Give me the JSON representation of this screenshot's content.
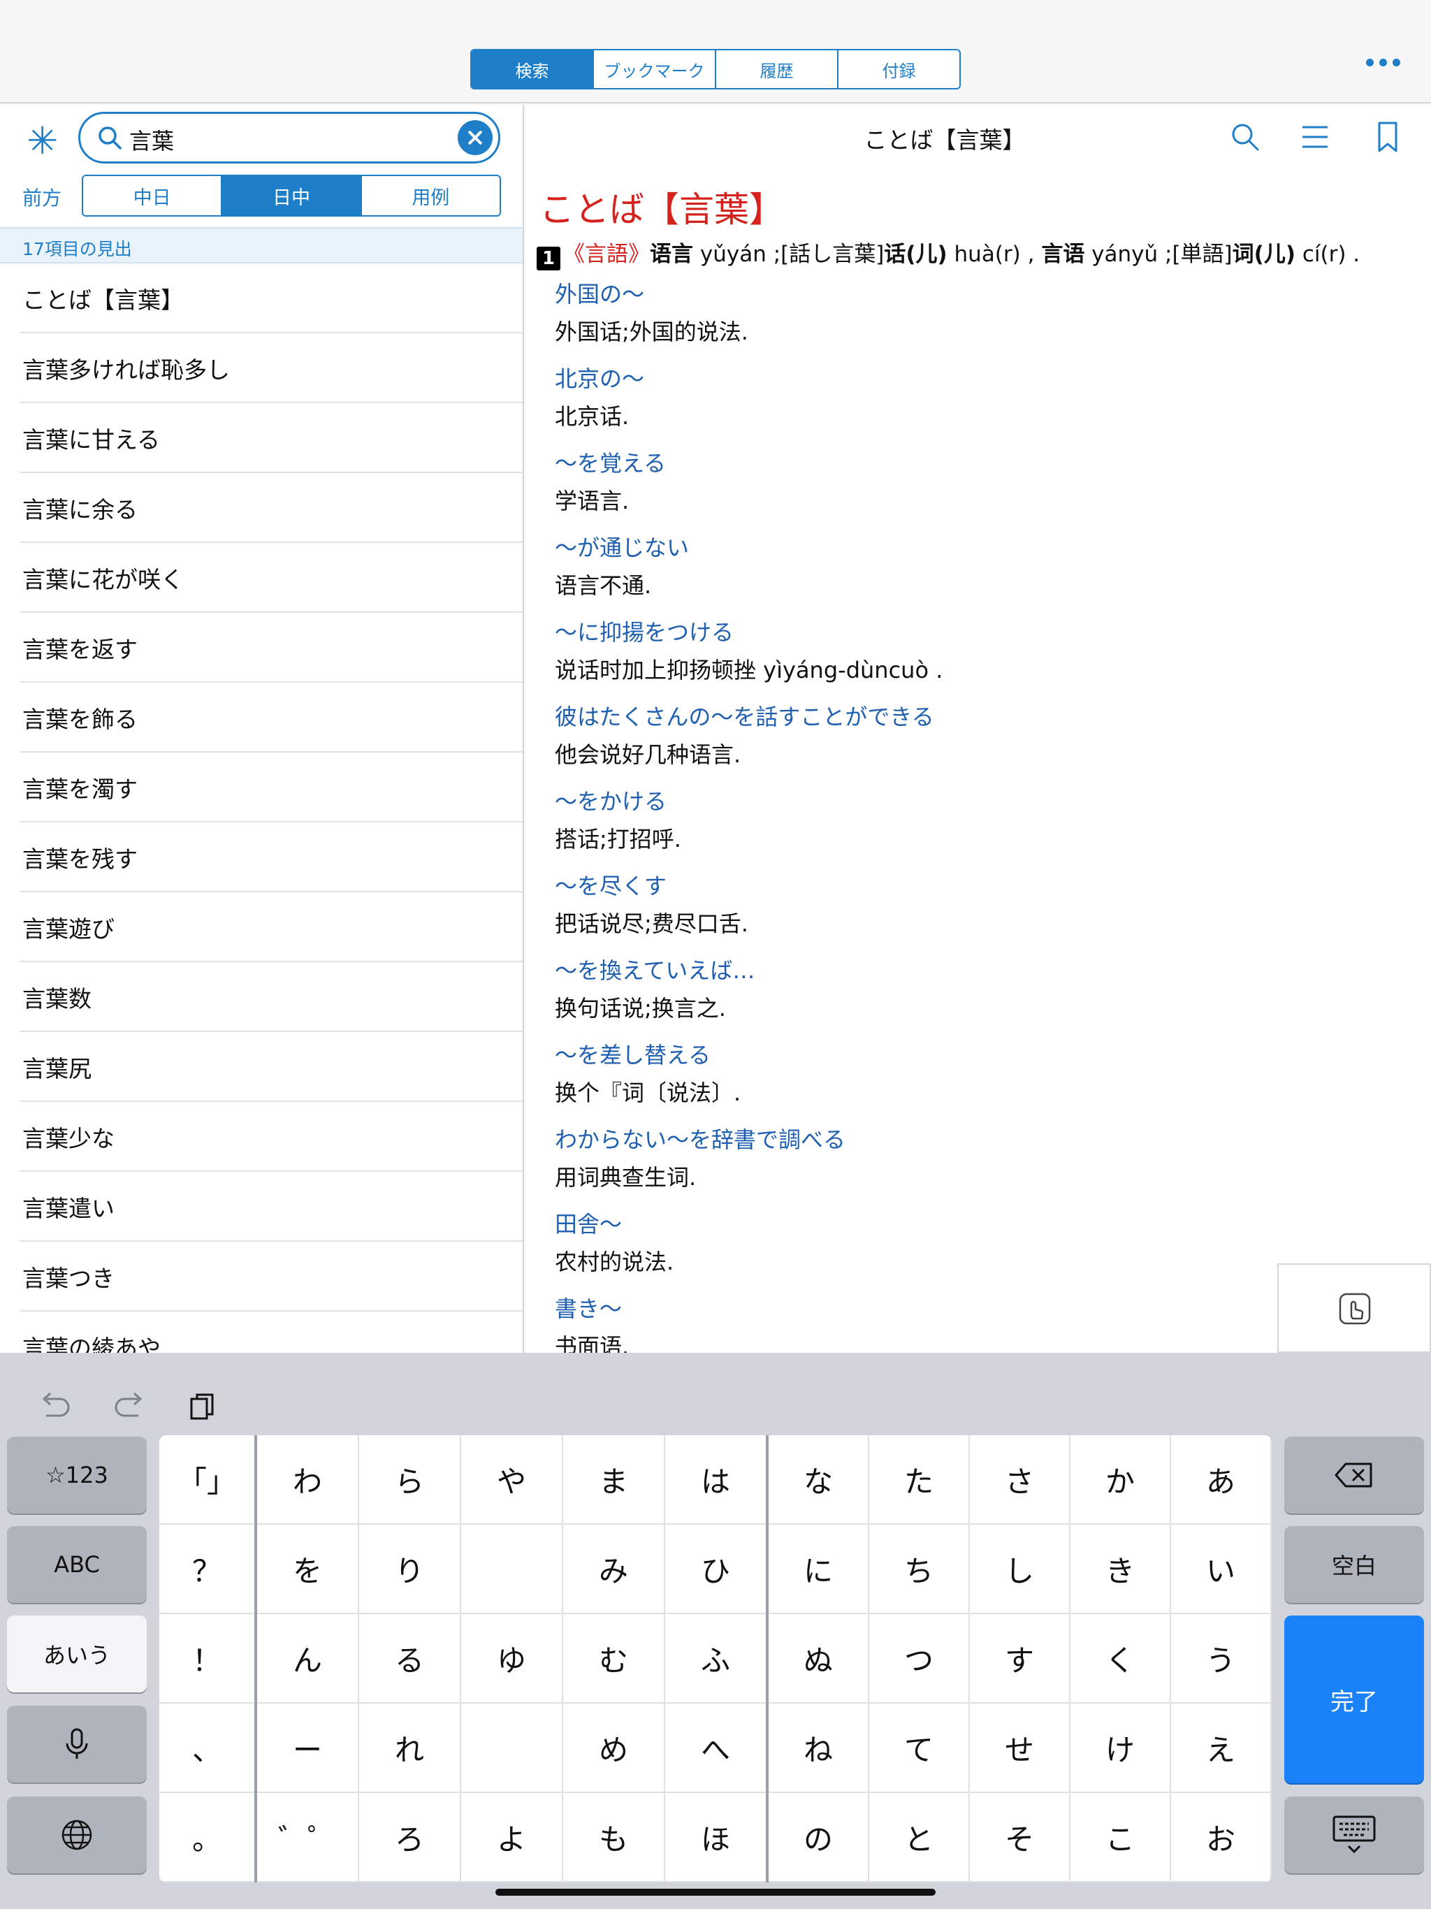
{
  "topbar": {
    "tabs": [
      {
        "label": "検索",
        "active": true
      },
      {
        "label": "ブックマーク",
        "active": false
      },
      {
        "label": "履歴",
        "active": false
      },
      {
        "label": "付録",
        "active": false
      }
    ],
    "more_icon": "more-dots-icon"
  },
  "left": {
    "search": {
      "value": "言葉",
      "icons": [
        "asterisk-icon",
        "search-icon",
        "clear-icon"
      ]
    },
    "direction_label": "前方",
    "modes": [
      {
        "label": "中日",
        "active": false
      },
      {
        "label": "日中",
        "active": true
      },
      {
        "label": "用例",
        "active": false
      }
    ],
    "count_text": "17項目の見出",
    "items": [
      "ことば【言葉】",
      "言葉多ければ恥多し",
      "言葉に甘える",
      "言葉に余る",
      "言葉に花が咲く",
      "言葉を返す",
      "言葉を飾る",
      "言葉を濁す",
      "言葉を残す",
      "言葉遊び",
      "言葉数",
      "言葉尻",
      "言葉少な",
      "言葉遣い",
      "言葉つき",
      "言葉の綾あや"
    ]
  },
  "right": {
    "header_title": "ことば【言葉】",
    "header_icons": [
      "search-icon",
      "list-icon",
      "bookmark-icon"
    ],
    "entry_title": "ことば【言葉】",
    "sense": {
      "num": "1",
      "category": "《言語》",
      "w1": "语言",
      "p1": " yǔyán ;[話し言葉]",
      "w2": "话(儿)",
      "p2": " huà(r) , ",
      "w3": "言语",
      "p3": " yányǔ ;[単語]",
      "w4": "词(儿)",
      "p4": " cí(r) ."
    },
    "examples": [
      {
        "jp": "外国の〜",
        "cn": "外国话;外国的说法."
      },
      {
        "jp": "北京の〜",
        "cn": "北京话."
      },
      {
        "jp": "〜を覚える",
        "cn": "学语言."
      },
      {
        "jp": "〜が通じない",
        "cn": "语言不通."
      },
      {
        "jp": "〜に抑揚をつける",
        "cn": "说话时加上抑扬顿挫 yìyáng-dùncuò ."
      },
      {
        "jp": "彼はたくさんの〜を話すことができる",
        "cn": "他会说好几种语言."
      },
      {
        "jp": "〜をかける",
        "cn": "搭话;打招呼."
      },
      {
        "jp": "〜を尽くす",
        "cn": "把话说尽;费尽口舌."
      },
      {
        "jp": "〜を換えていえば…",
        "cn": "换句话说;换言之."
      },
      {
        "jp": "〜を差し替える",
        "cn": "换个『词〔说法〕."
      },
      {
        "jp": "わからない〜を辞書で調べる",
        "cn": "用词典查生词."
      },
      {
        "jp": "田舎〜",
        "cn": "农村的说法."
      },
      {
        "jp": "書き〜",
        "cn": "书面语."
      }
    ],
    "touch_icon": "touch-hand-icon"
  },
  "keyboard": {
    "toolbar_icons": [
      "undo-icon",
      "redo-icon",
      "copy-icon"
    ],
    "left_keys": [
      "☆123",
      "ABC",
      "あいう",
      "mic-icon",
      "globe-icon"
    ],
    "grid": [
      [
        "「」",
        "わ",
        "ら",
        "や",
        "ま",
        "は",
        "な",
        "た",
        "さ",
        "か",
        "あ"
      ],
      [
        "？",
        "を",
        "り",
        "",
        "み",
        "ひ",
        "に",
        "ち",
        "し",
        "き",
        "い"
      ],
      [
        "！",
        "ん",
        "る",
        "ゆ",
        "む",
        "ふ",
        "ぬ",
        "つ",
        "す",
        "く",
        "う"
      ],
      [
        "、",
        "ー",
        "れ",
        "",
        "め",
        "へ",
        "ね",
        "て",
        "せ",
        "け",
        "え"
      ],
      [
        "。",
        "゛゜",
        "ろ",
        "よ",
        "も",
        "ほ",
        "の",
        "と",
        "そ",
        "こ",
        "お"
      ]
    ],
    "right_keys": {
      "delete": "backspace-icon",
      "space": "空白",
      "done": "完了",
      "hide": "keyboard-hide-icon"
    }
  }
}
